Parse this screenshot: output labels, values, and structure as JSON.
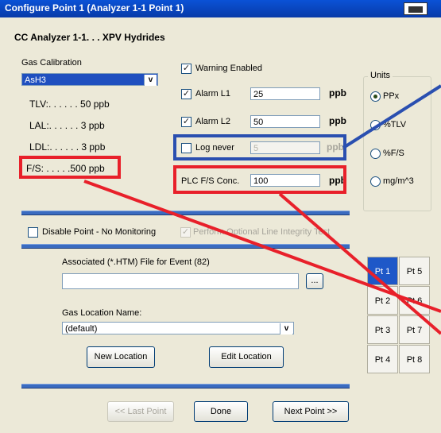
{
  "window": {
    "title": "Configure Point 1  (Analyzer 1-1  Point 1)"
  },
  "header": {
    "analyzer": "CC Analyzer 1-1. . .  XPV Hydrides"
  },
  "gas": {
    "group_label": "Gas Calibration",
    "selected": "AsH3",
    "tlv": "TLV:. . . . . .  50  ppb",
    "lal": "LAL:. . . . . .  3  ppb",
    "ldl": "LDL:. . . . . .  3  ppb",
    "fs": "F/S: . . . . .500  ppb"
  },
  "alarms": {
    "warning_label": "Warning Enabled",
    "l1_label": "Alarm L1",
    "l1_value": "25",
    "l2_label": "Alarm L2",
    "l2_value": "50",
    "log_label": "Log never",
    "log_value": "5",
    "plc_label": "PLC F/S Conc.",
    "plc_value": "100",
    "unit": "ppb",
    "check_mark": "✓"
  },
  "units": {
    "label": "Units",
    "options": [
      "PPx",
      "%TLV",
      "%F/S",
      "mg/m^3"
    ]
  },
  "monitoring": {
    "disable_label": "Disable Point  - No Monitoring",
    "integrity_label": "Perform Optional Line Integrity Test"
  },
  "event_file": {
    "label": "Associated (*.HTM) File for Event (82)",
    "value": "",
    "browse": "..."
  },
  "location": {
    "label": "Gas Location Name:",
    "selected": "(default)",
    "new_button": "New Location",
    "edit_button": "Edit Location"
  },
  "points": [
    "Pt 1",
    "Pt 5",
    "Pt 2",
    "Pt 6",
    "Pt 3",
    "Pt 7",
    "Pt 4",
    "Pt 8"
  ],
  "footer": {
    "last": "<< Last Point",
    "done": "Done",
    "next": "Next Point >>"
  },
  "colors": {
    "title_bar": "#0a52d6",
    "highlight_red": "#e8202a",
    "highlight_blue": "#2a4fb0",
    "separator": "#3a6bc0"
  },
  "combo_arrow": "v"
}
